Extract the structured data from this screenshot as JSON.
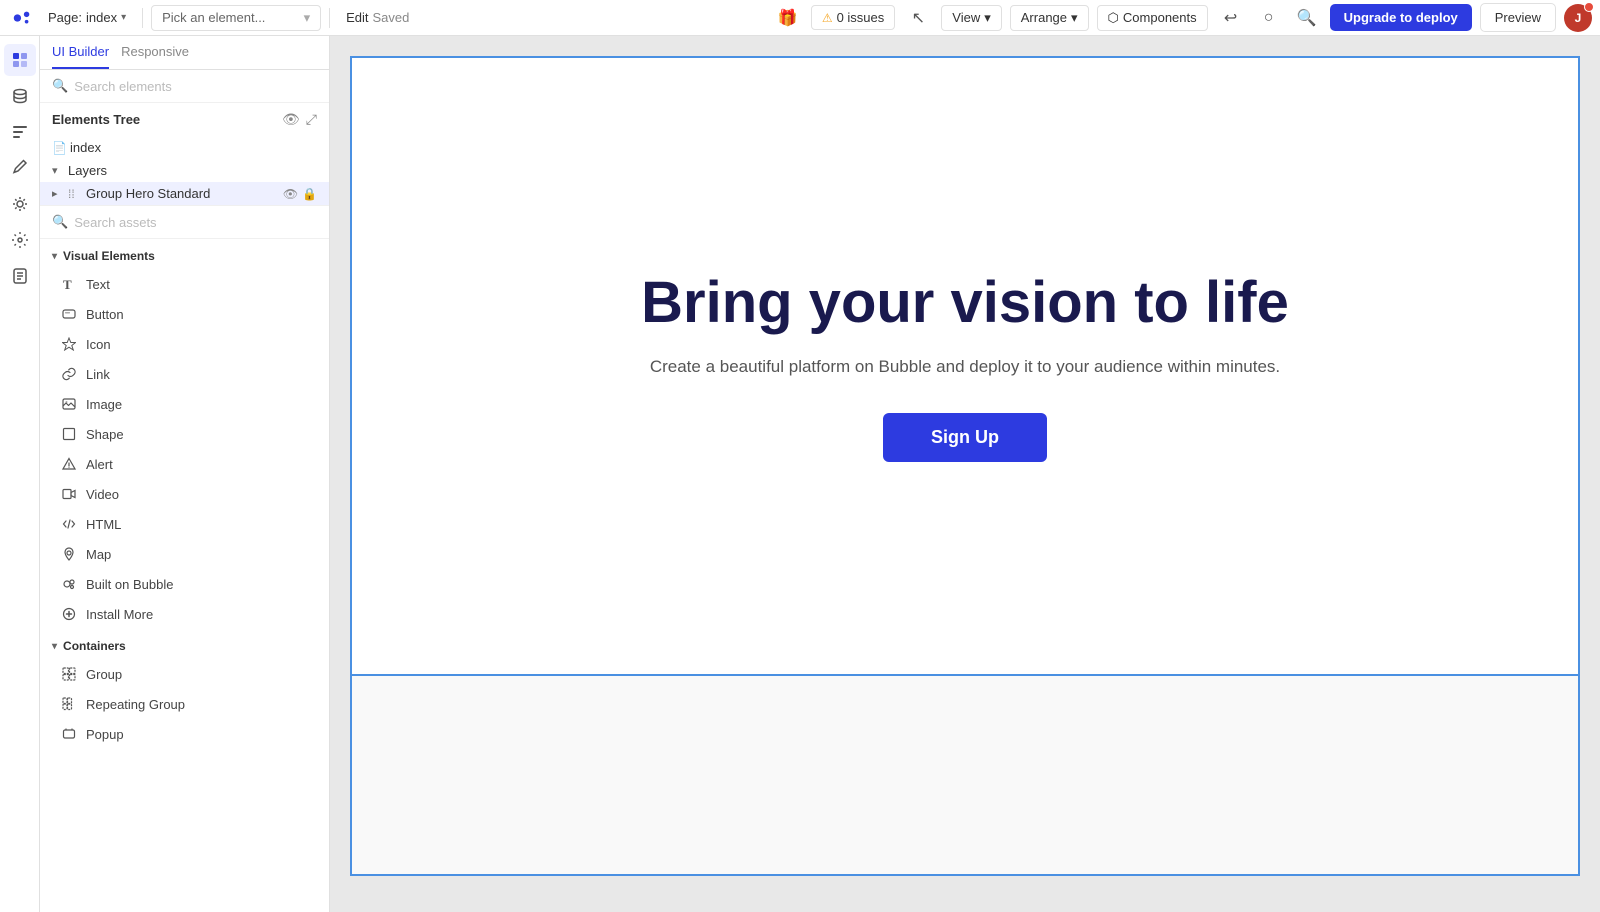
{
  "topbar": {
    "logo_alt": "Bubble Logo",
    "page_label": "Page:",
    "page_name": "index",
    "chevron_icon": "▾",
    "pick_element_placeholder": "Pick an element...",
    "edit_label": "Edit",
    "saved_label": "Saved",
    "issues_count": "0 issues",
    "view_label": "View",
    "view_chevron": "▾",
    "arrange_label": "Arrange",
    "arrange_chevron": "▾",
    "components_label": "Components",
    "upgrade_label": "Upgrade to deploy",
    "preview_label": "Preview"
  },
  "left_panel": {
    "tab_ui_builder": "UI Builder",
    "tab_responsive": "Responsive",
    "search_elements_placeholder": "Search elements",
    "elements_tree_title": "Elements Tree",
    "tree_page_item": "index",
    "tree_layers_label": "Layers",
    "tree_group_hero": "Group Hero Standard",
    "search_assets_placeholder": "Search assets",
    "visual_elements_section": "Visual Elements",
    "containers_section": "Containers",
    "elements": {
      "text": "Text",
      "button": "Button",
      "icon": "Icon",
      "link": "Link",
      "image": "Image",
      "shape": "Shape",
      "alert": "Alert",
      "video": "Video",
      "html": "HTML",
      "map": "Map",
      "built_on_bubble": "Built on Bubble",
      "install_more": "Install More",
      "group": "Group",
      "repeating_group": "Repeating Group",
      "popup": "Popup"
    }
  },
  "canvas": {
    "hero_title": "Bring your vision to life",
    "hero_subtitle": "Create a beautiful platform on Bubble and deploy it to your audience within minutes.",
    "hero_button": "Sign Up"
  },
  "icons": {
    "eye": "👁",
    "lock": "🔒",
    "search": "🔍",
    "chevron_right": "›",
    "chevron_down": "▾",
    "collapse": "▾",
    "expand": "▸",
    "warning": "⚠",
    "gift": "🎁",
    "components_cube": "⬡",
    "undo": "↩",
    "circle": "○",
    "pointer": "↖"
  },
  "colors": {
    "accent": "#2d3be0",
    "canvas_border": "#4a90e2",
    "hero_title": "#1a1a4e",
    "selected_bg": "#eef0ff"
  }
}
